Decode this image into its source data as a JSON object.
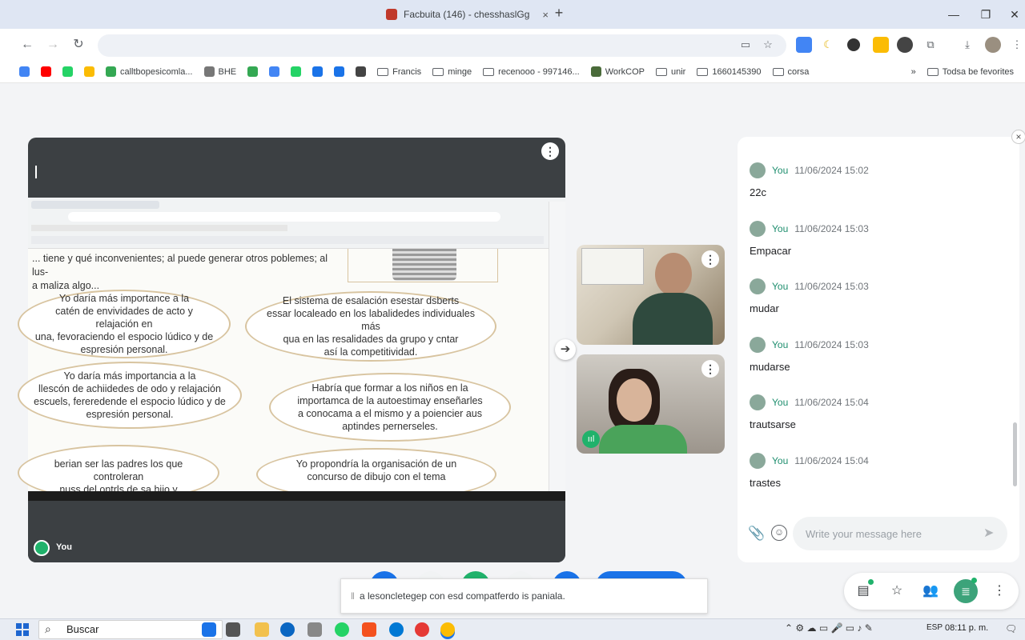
{
  "browser": {
    "tab_title": "Facbuita (146) - chesshaslGg",
    "new_tab": "+",
    "tab_close": "×",
    "window": {
      "minimize": "—",
      "maximize": "❐",
      "close": "✕"
    }
  },
  "bookmarks": [
    {
      "label": "",
      "color": "#4285f4"
    },
    {
      "label": "",
      "color": "#ff0000"
    },
    {
      "label": "",
      "color": "#25d366"
    },
    {
      "label": "",
      "color": "#fbbc04"
    },
    {
      "label": "calltbopesicomla...",
      "color": "#34a853"
    },
    {
      "label": "BHE",
      "color": "#777777"
    },
    {
      "label": "",
      "color": "#34a853"
    },
    {
      "label": "",
      "color": "#4285f4"
    },
    {
      "label": "",
      "color": "#25d366"
    },
    {
      "label": "",
      "color": "#1a73e8"
    },
    {
      "label": "",
      "color": "#1a73e8"
    },
    {
      "label": "",
      "color": "#444444"
    },
    {
      "label": "Francis",
      "folder": true
    },
    {
      "label": "minge",
      "folder": true
    },
    {
      "label": "recenooo - 997146...",
      "folder": true
    },
    {
      "label": "WorkCOP",
      "color": "#4a6b3a"
    },
    {
      "label": "unir",
      "folder": true
    },
    {
      "label": "1660145390",
      "folder": true
    },
    {
      "label": "corsa",
      "folder": true
    }
  ],
  "bookmarks_more": "»",
  "bookmarks_all": "Todsa be fevorites",
  "presentation": {
    "presenter_label": "You",
    "top_text": "... tiene y qué inconvenientes; al puede generar otros poblemes; al lus-\na maliza algo...",
    "bubbles": [
      {
        "text": "Yo daría más importance a la\ncatén de envividades de acto y relajación en\nuna, fevoraciendo el espocio lúdico y de\nespresión personal."
      },
      {
        "text": "El sistema de esalación esestar dsberts\nessar localeado en los labalidedes individuales más\nqua en las resalidades da grupo y cntar\nasí la competitividad."
      },
      {
        "text": "Yo daría más importancia a la\nllescón de achiidedes de odo y relajación\nescuels, fereredende el espocio lúdico y de\nespresión personal."
      },
      {
        "text": "Habría que formar a los niños en la\nimportamca de la autoestimay enseñarles\na conocama a el mismo y a poiencier aus\naptindes pernerseles."
      },
      {
        "text": "berian ser las padres los que controleran\nnuss del ontrls de sa hijo y manteileran"
      },
      {
        "text": "Yo propondría la organisación de un\nconcurso de dibujo con el tema"
      }
    ]
  },
  "chat": {
    "messages": [
      {
        "sender": "You",
        "time": "11/06/2024 15:02",
        "text": "22c"
      },
      {
        "sender": "You",
        "time": "11/06/2024 15:03",
        "text": "Empacar"
      },
      {
        "sender": "You",
        "time": "11/06/2024 15:03",
        "text": "mudar"
      },
      {
        "sender": "You",
        "time": "11/06/2024 15:03",
        "text": "mudarse"
      },
      {
        "sender": "You",
        "time": "11/06/2024 15:04",
        "text": "trautsarse"
      },
      {
        "sender": "You",
        "time": "11/06/2024 15:04",
        "text": "trastes"
      }
    ],
    "input_placeholder": "Write your message here",
    "close": "×"
  },
  "toast": {
    "text": "a lesoncletegep con esd compatferdo is paniala."
  },
  "taskbar": {
    "search": "Buscar",
    "lang": "ESP",
    "time": "08:11 p. m."
  },
  "colors": {
    "accent": "#1e8e6e",
    "meet_green": "#20b26b",
    "chat_active": "#3ca37a"
  }
}
